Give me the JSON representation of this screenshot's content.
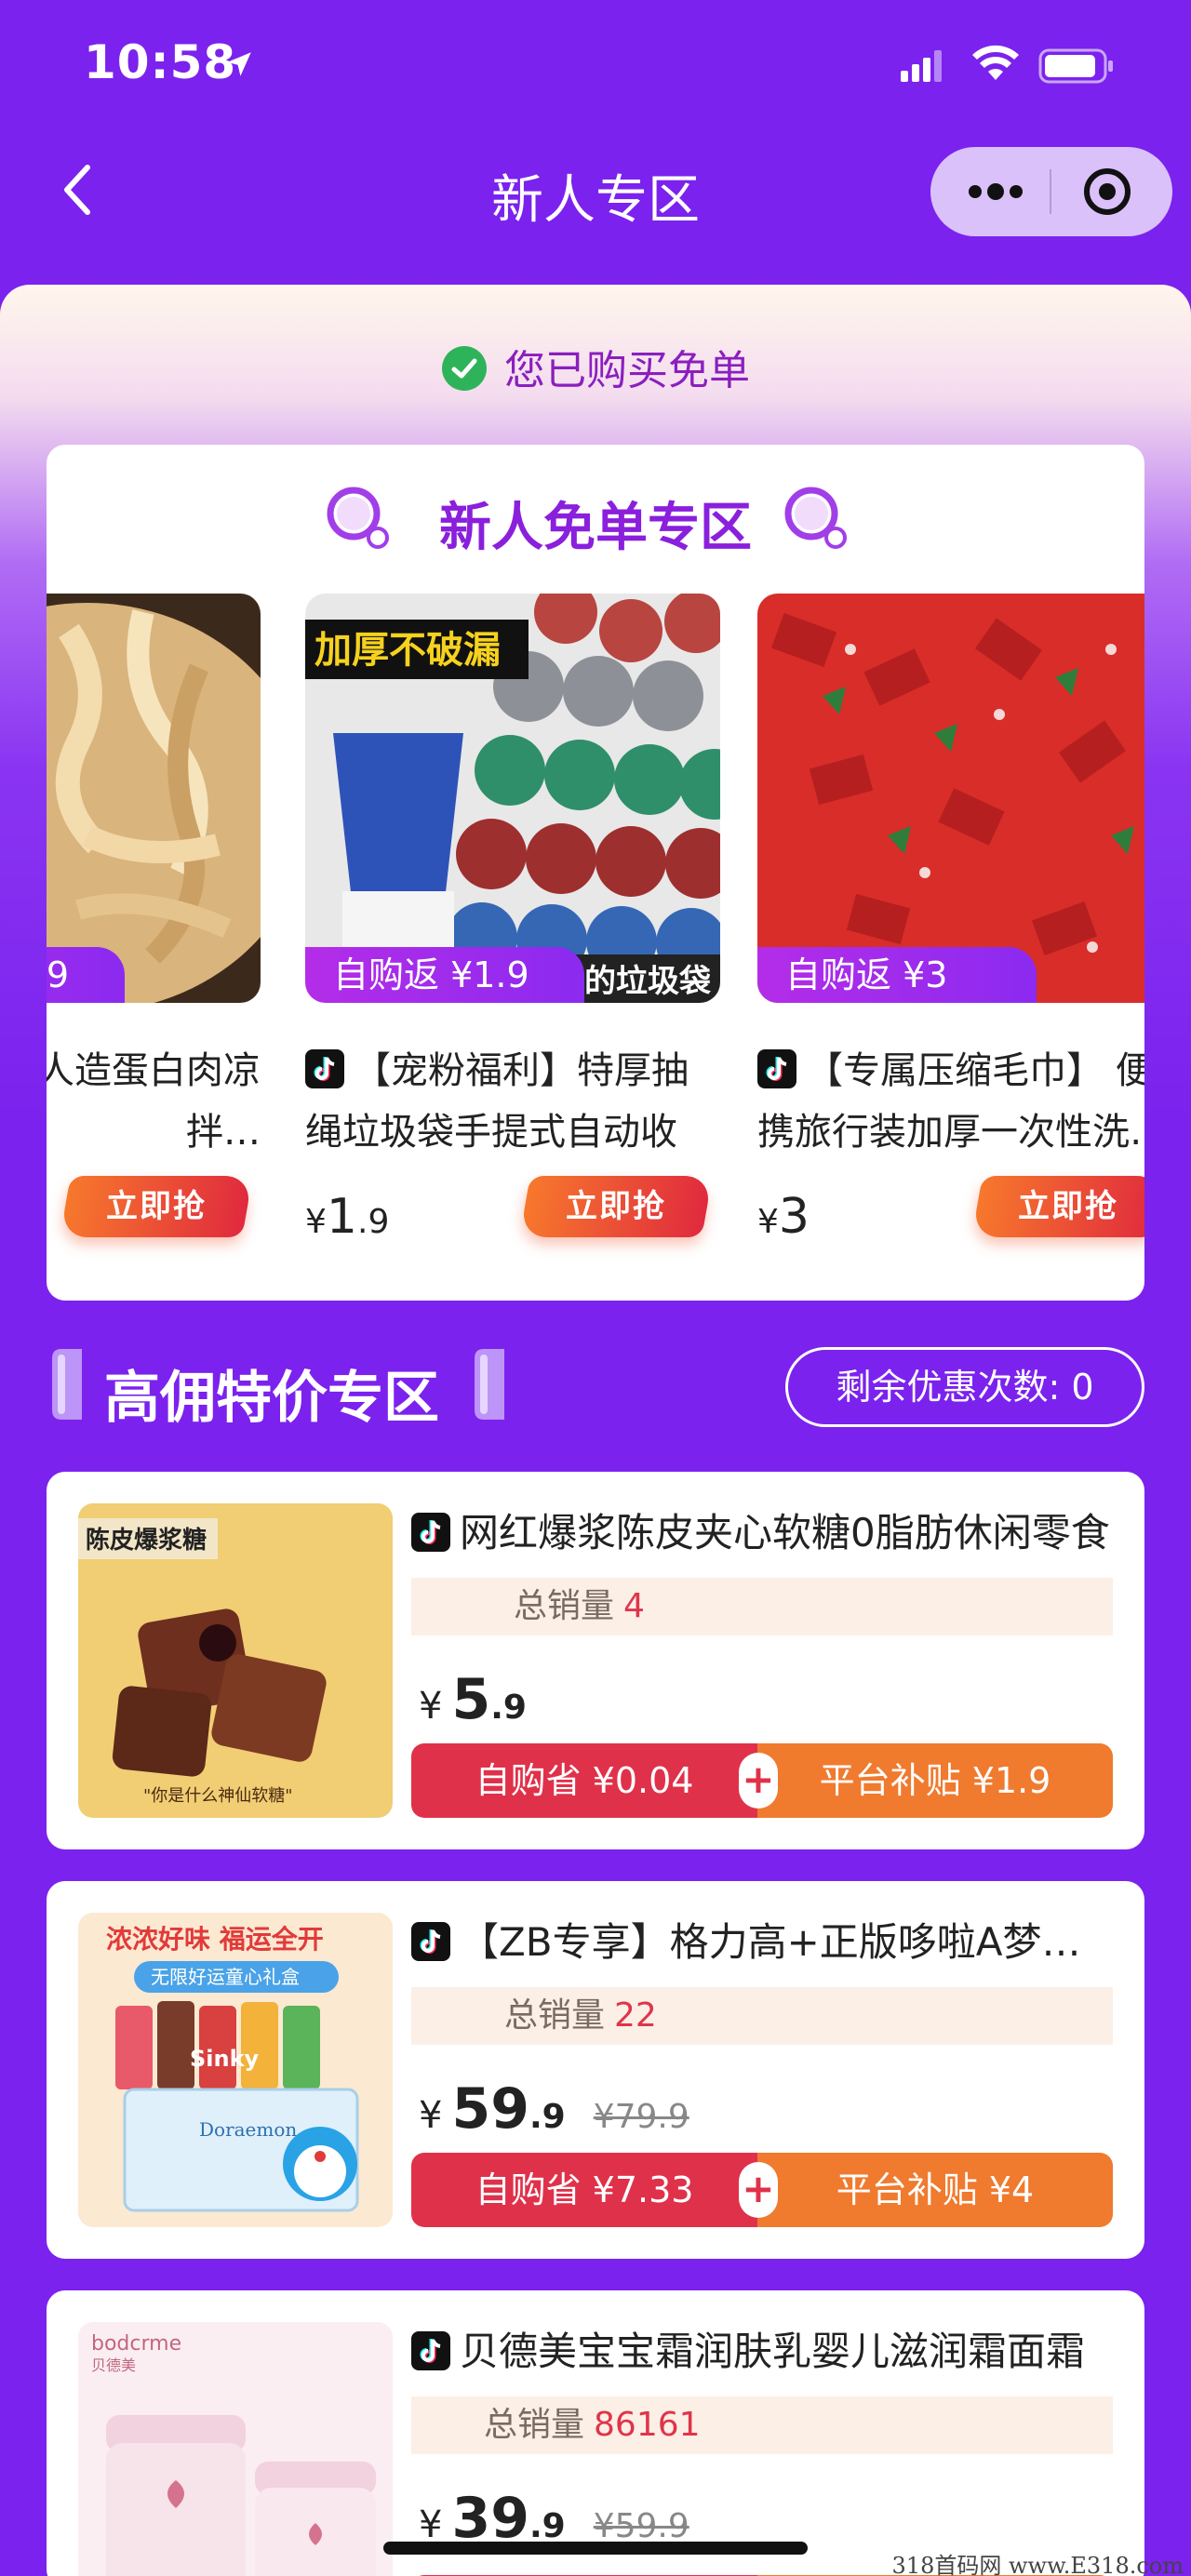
{
  "status_bar": {
    "time": "10:58"
  },
  "nav": {
    "title": "新人专区"
  },
  "banner": {
    "purchased_text": "您已购买免单"
  },
  "free_zone": {
    "title": "新人免单专区",
    "items": [
      {
        "name": "制品干货人造蛋白肉凉拌…",
        "rebate": "9",
        "price_symbol": "",
        "price_int": "",
        "price_dec": "",
        "button": "立即抢"
      },
      {
        "name": "【宠粉福利】特厚抽绳垃圾袋手提式自动收口…",
        "rebate": "自购返 ¥1.9",
        "img_tag": "加厚不破漏",
        "img_bottom": "的垃圾袋",
        "price_symbol": "¥",
        "price_int": "1",
        "price_dec": ".9",
        "button": "立即抢"
      },
      {
        "name": "【专属压缩毛巾】 便携旅行装加厚一次性洗…",
        "rebate": "自购返 ¥3",
        "price_symbol": "¥",
        "price_int": "3",
        "price_dec": "",
        "button": "立即抢"
      }
    ]
  },
  "high_commission": {
    "title": "高佣特价专区",
    "remaining": "剩余优惠次数: 0",
    "sales_label": "总销量",
    "plus": "+",
    "items": [
      {
        "name": "网红爆浆陈皮夹心软糖0脂肪休闲零食",
        "sales": "4",
        "currency": "¥",
        "price_int": "5",
        "price_dec": ".9",
        "orig": "",
        "self_save": "自购省 ¥0.04",
        "subsidy": "平台补贴 ¥1.9",
        "img_tag": "陈皮爆浆糖",
        "img_caption": "\"你是什么神仙软糖\""
      },
      {
        "name": "【ZB专享】格力高+正版哆啦A梦礼盒",
        "sales": "22",
        "currency": "¥",
        "price_int": "59",
        "price_dec": ".9",
        "orig": "¥79.9",
        "self_save": "自购省 ¥7.33",
        "subsidy": "平台补贴 ¥4",
        "img_tag": "浓浓好味 福运全开",
        "img_sub": "无限好运童心礼盒",
        "img_brand": "Sinky",
        "img_box": "Doraemon"
      },
      {
        "name": "贝德美宝宝霜润肤乳婴儿滋润霜面霜",
        "sales": "86161",
        "currency": "¥",
        "price_int": "39",
        "price_dec": ".9",
        "orig": "¥59.9",
        "self_save": "",
        "subsidy": "",
        "img_brand": "bodcrme",
        "img_brand_cn": "贝德美"
      }
    ]
  },
  "watermark": "318首码网 www.E318.com",
  "colors": {
    "brand_purple": "#7b22ee",
    "red": "#e0314a",
    "orange": "#f07a2e"
  },
  "icons": [
    "location-arrow-icon",
    "signal-icon",
    "wifi-icon",
    "battery-icon",
    "back-icon",
    "more-icon",
    "target-icon",
    "check-icon",
    "bubble-icon",
    "tiktok-icon",
    "bracket-icon"
  ]
}
